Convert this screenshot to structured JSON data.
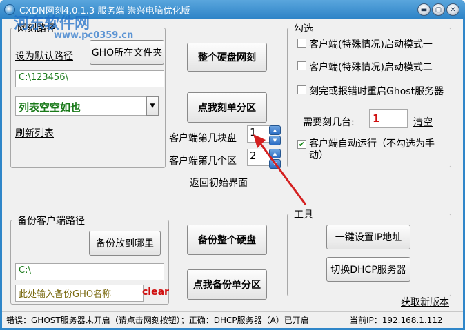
{
  "title": "CXDN网刻4.0.1.3 服务端 崇兴电脑优化版",
  "watermark": {
    "text": "河东软件网",
    "url": "www.pc0359.cn"
  },
  "path_group": {
    "legend": "网刻路径",
    "set_default": "设为默认路径",
    "gho_folder_button": "GHO所在文件夹",
    "path_value": "C:\\123456\\",
    "list_value": "列表空空如也",
    "refresh": "刷新列表"
  },
  "center": {
    "whole_disk_button": "整个硬盘网刻",
    "single_partition_button": "点我刻单分区",
    "disk_label": "客户端第几块盘",
    "disk_value": "1",
    "partition_label": "客户端第几个区",
    "partition_value": "2",
    "return_link": "返回初始界面",
    "backup_disk_button": "备份整个硬盘",
    "backup_partition_button": "点我备份单分区"
  },
  "options_group": {
    "legend": "勾选",
    "opt1": "客户端(特殊情况)启动模式一",
    "opt2": "客户端(特殊情况)启动模式二",
    "opt3": "刻完或报错时重启Ghost服务器",
    "count_label": "需要刻几台:",
    "count_value": "1",
    "clear": "清空",
    "autorun": "客户端自动运行（不勾选为手动）"
  },
  "backup_group": {
    "legend": "备份客户端路径",
    "where_button": "备份放到哪里",
    "path_value": "C:\\",
    "name_placeholder": "此处输入备份GHO名称",
    "clear": "clear"
  },
  "tools_group": {
    "legend": "工具",
    "ip_button": "一键设置IP地址",
    "dhcp_button": "切换DHCP服务器",
    "new_version": "获取新版本"
  },
  "status": {
    "message": "错误：GHOST服务器未开启（请点击网刻按钮）；正确：DHCP服务器（A）已开启",
    "ip": "当前IP：192.168.1.112"
  },
  "colors": {
    "green": "#1a7a1a",
    "red": "#d01010",
    "olive": "#7a6a10",
    "titlebar": "#2c82c6"
  }
}
